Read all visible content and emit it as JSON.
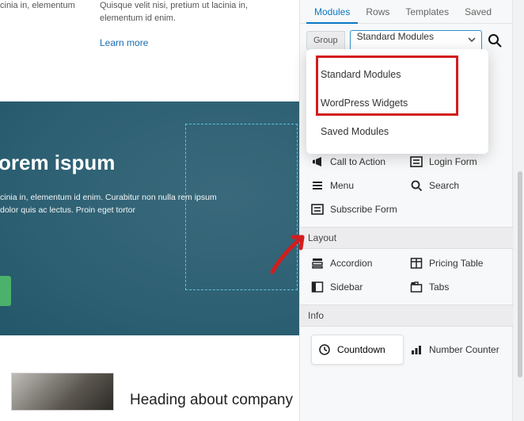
{
  "page": {
    "col_a_text": "cinia in, elementum",
    "col_b_text": "Quisque velit nisi, pretium ut lacinia in, elementum id enim.",
    "learn_more": "Learn more",
    "hero_title": "orem ispum",
    "hero_body": "cinia in, elementum id enim. Curabitur non nulla rem ipsum dolor quis ac lectus. Proin eget tortor",
    "heading2": "Heading about company"
  },
  "panel": {
    "tabs": {
      "modules": "Modules",
      "rows": "Rows",
      "templates": "Templates",
      "saved": "Saved"
    },
    "group_label": "Group",
    "group_selected": "Standard Modules",
    "dropdown": {
      "opt1": "Standard Modules",
      "opt2": "WordPress Widgets",
      "opt3": "Saved Modules"
    },
    "sections": {
      "layout": "Layout",
      "info": "Info"
    },
    "modules": {
      "call_to_action": "Call to Action",
      "login_form": "Login Form",
      "menu": "Menu",
      "search": "Search",
      "subscribe_form": "Subscribe Form",
      "accordion": "Accordion",
      "pricing_table": "Pricing Table",
      "sidebar": "Sidebar",
      "tabs": "Tabs",
      "countdown": "Countdown",
      "number_counter": "Number Counter"
    }
  }
}
